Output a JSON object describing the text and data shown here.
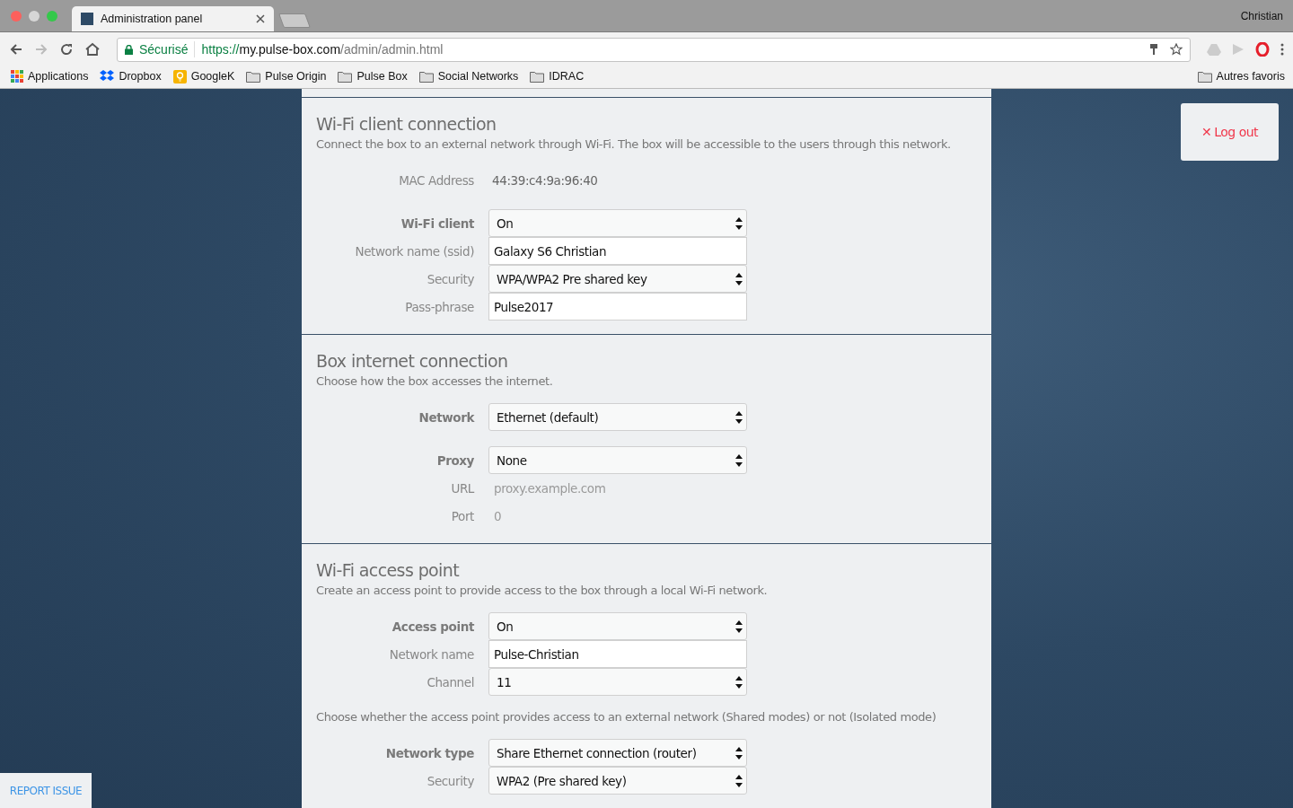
{
  "browser": {
    "tab_title": "Administration panel",
    "profile": "Christian",
    "security_label": "Sécurisé",
    "url_scheme": "https://",
    "url_host": "my.pulse-box.com",
    "url_path": "/admin/admin.html",
    "bookmarks": [
      {
        "kind": "apps",
        "label": "Applications"
      },
      {
        "kind": "dropbox",
        "label": "Dropbox"
      },
      {
        "kind": "note",
        "label": "GoogleK"
      },
      {
        "kind": "folder",
        "label": "Pulse Origin"
      },
      {
        "kind": "folder",
        "label": "Pulse Box"
      },
      {
        "kind": "folder",
        "label": "Social Networks"
      },
      {
        "kind": "folder",
        "label": "IDRAC"
      }
    ],
    "other_bookmarks": "Autres favoris"
  },
  "logout": {
    "icon": "✕",
    "label": "Log out"
  },
  "report_issue": "REPORT ISSUE",
  "sections": [
    {
      "title": "Wi-Fi client connection",
      "description": "Connect the box to an external network through Wi-Fi. The box will be accessible to the users through this network.",
      "blocks": [
        {
          "kind": "rows",
          "rows": [
            {
              "kind": "static",
              "label": "MAC Address",
              "bold": false,
              "value": "44:39:c4:9a:96:40"
            }
          ]
        },
        {
          "kind": "rows",
          "rows": [
            {
              "kind": "select",
              "label": "Wi-Fi client",
              "bold": true,
              "value": "On"
            },
            {
              "kind": "input",
              "label": "Network name (ssid)",
              "bold": false,
              "value": "Galaxy S6 Christian"
            },
            {
              "kind": "select",
              "label": "Security",
              "bold": false,
              "value": "WPA/WPA2 Pre shared key"
            },
            {
              "kind": "input",
              "label": "Pass-phrase",
              "bold": false,
              "value": "Pulse2017"
            }
          ]
        }
      ]
    },
    {
      "title": "Box internet connection",
      "description": "Choose how the box accesses the internet.",
      "blocks": [
        {
          "kind": "rows",
          "rows": [
            {
              "kind": "select",
              "label": "Network",
              "bold": true,
              "value": "Ethernet (default)"
            }
          ]
        },
        {
          "kind": "rows",
          "rows": [
            {
              "kind": "select",
              "label": "Proxy",
              "bold": true,
              "value": "None"
            },
            {
              "kind": "disabled",
              "label": "URL",
              "bold": false,
              "placeholder": "proxy.example.com"
            },
            {
              "kind": "disabled",
              "label": "Port",
              "bold": false,
              "placeholder": "0"
            }
          ]
        }
      ]
    },
    {
      "title": "Wi-Fi access point",
      "description": "Create an access point to provide access to the box through a local Wi-Fi network.",
      "blocks": [
        {
          "kind": "rows",
          "rows": [
            {
              "kind": "select",
              "label": "Access point",
              "bold": true,
              "value": "On"
            },
            {
              "kind": "input",
              "label": "Network name",
              "bold": false,
              "value": "Pulse-Christian"
            },
            {
              "kind": "select",
              "label": "Channel",
              "bold": false,
              "value": "11"
            }
          ]
        },
        {
          "kind": "note",
          "text": "Choose whether the access point provides access to an external network (Shared modes) or not (Isolated mode)"
        },
        {
          "kind": "rows",
          "rows": [
            {
              "kind": "select",
              "label": "Network type",
              "bold": true,
              "value": "Share Ethernet connection (router)"
            },
            {
              "kind": "select",
              "label": "Security",
              "bold": false,
              "value": "WPA2 (Pre shared key)"
            }
          ]
        }
      ]
    }
  ]
}
